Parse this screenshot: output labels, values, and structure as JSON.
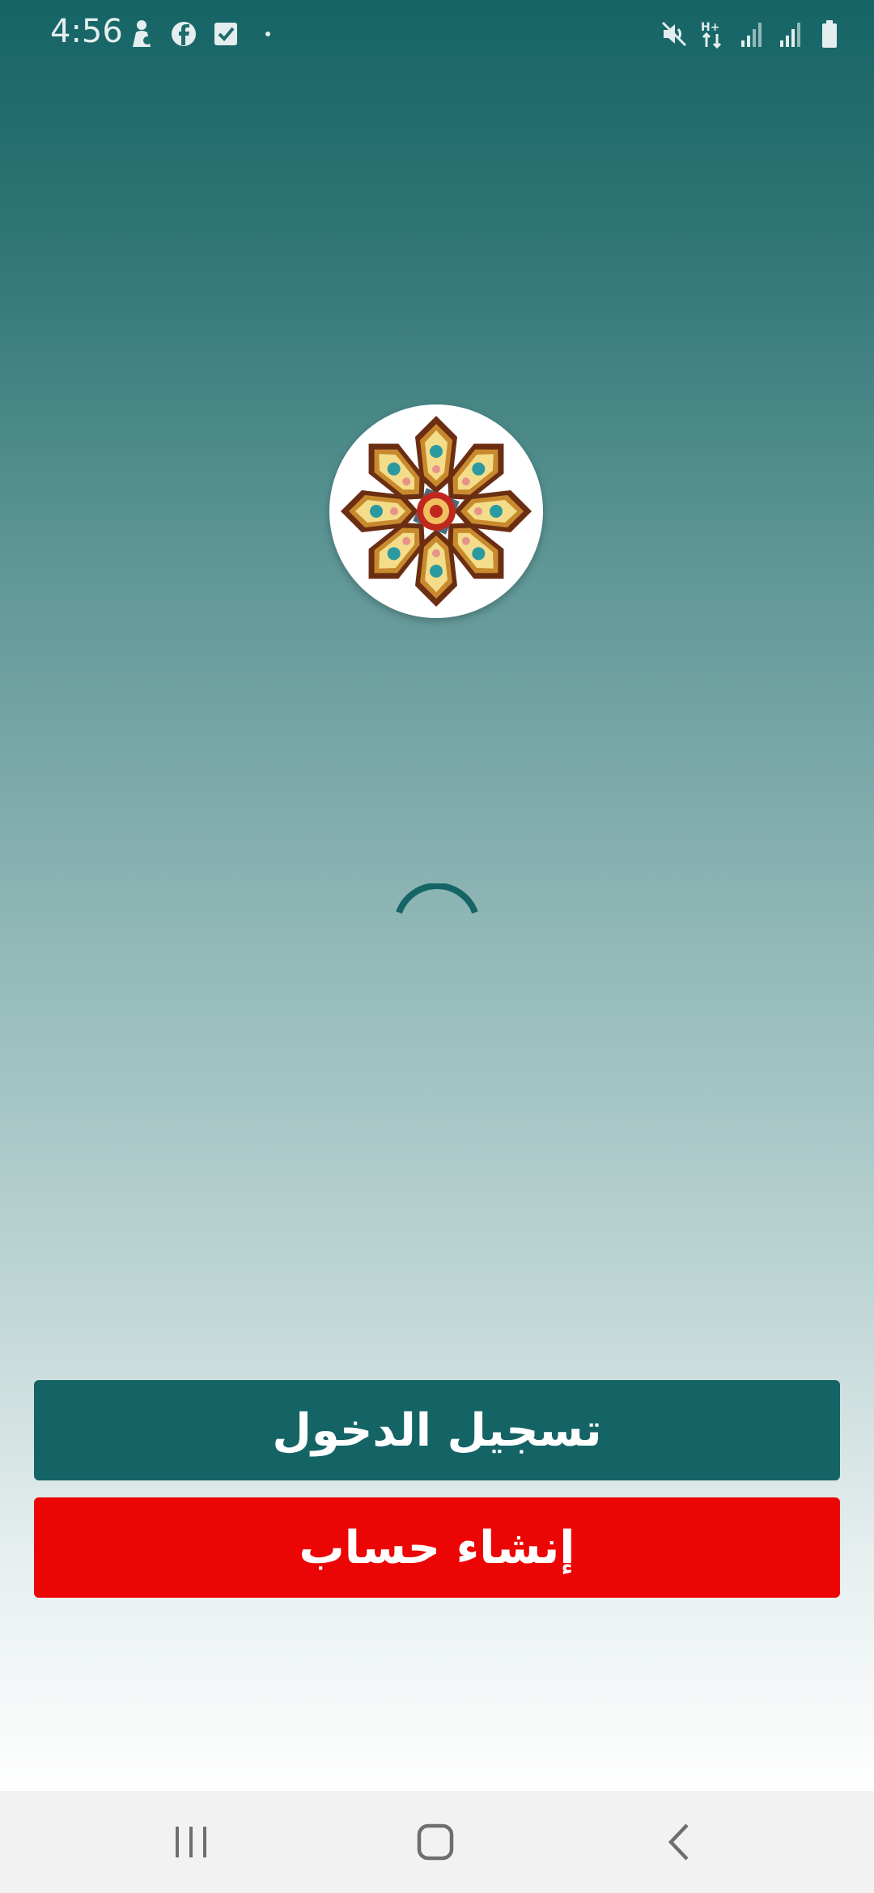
{
  "status_bar": {
    "time": "4:56",
    "left_icons": [
      "person-notification-icon",
      "facebook-icon",
      "checkbox-notification-icon",
      "dot-icon"
    ],
    "right_icons": [
      "mute-icon",
      "hplus-data-icon",
      "signal-icon",
      "signal-icon",
      "battery-icon"
    ]
  },
  "logo": {
    "icon": "arabesque-star-logo"
  },
  "loading": {
    "icon": "spinner-icon"
  },
  "buttons": {
    "login_label": "تسجيل الدخول",
    "register_label": "إنشاء حساب"
  },
  "nav_bar": {
    "recents_icon": "recents-icon",
    "home_icon": "home-icon",
    "back_icon": "back-icon"
  },
  "colors": {
    "primary_teal": "#146466",
    "register_red": "#ec0505",
    "nav_background": "#f2f2f2"
  }
}
